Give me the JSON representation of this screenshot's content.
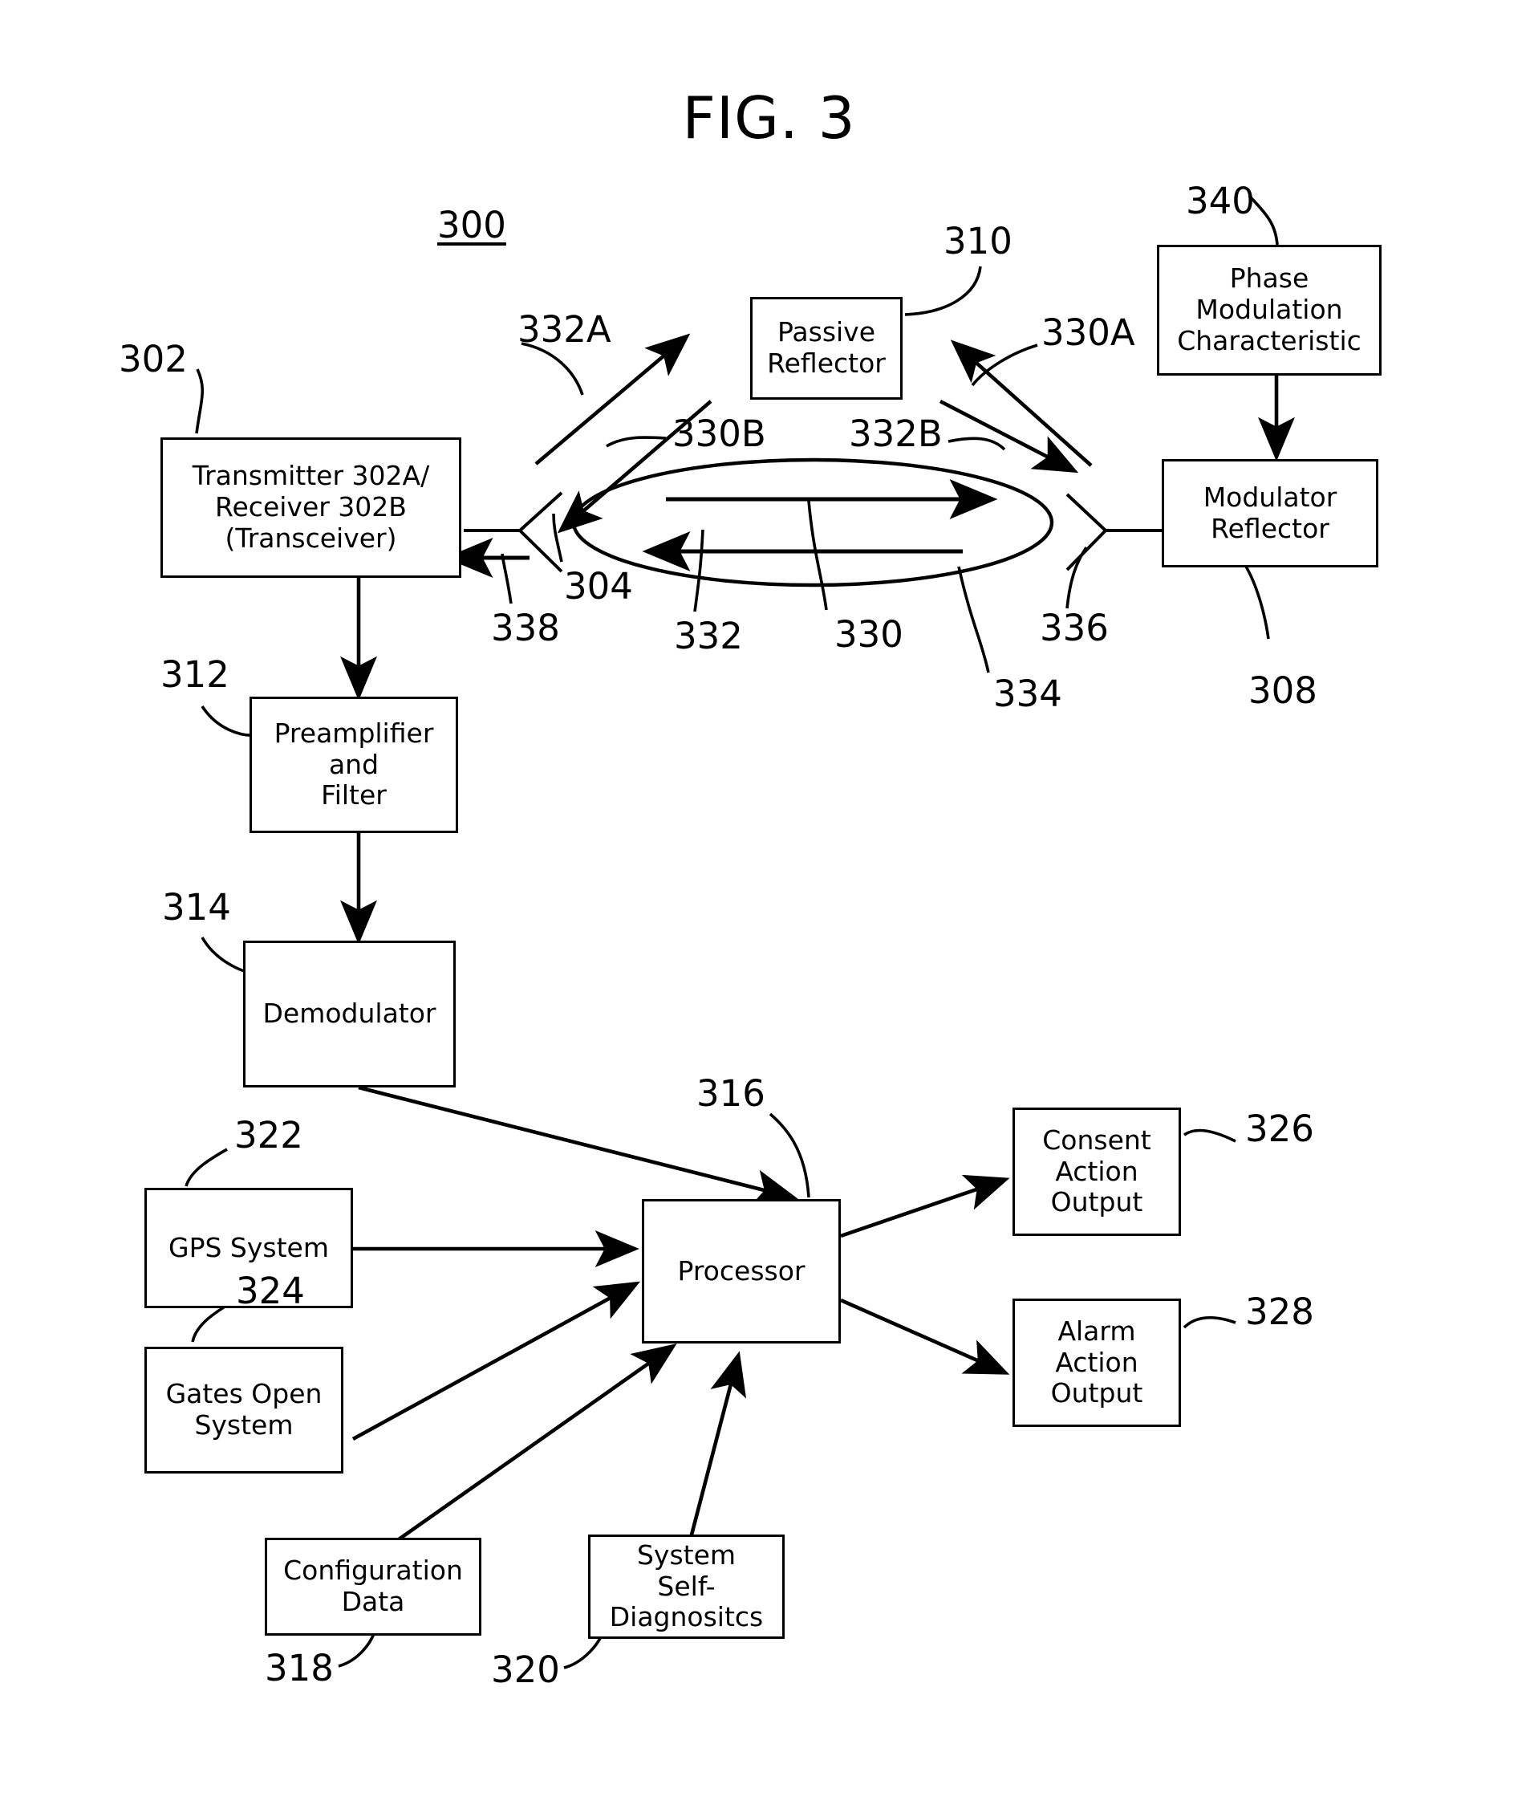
{
  "figure": {
    "title": "FIG. 3",
    "system_ref": "300"
  },
  "boxes": {
    "transceiver": {
      "label": "Transmitter 302A/\nReceiver 302B\n(Transceiver)",
      "ref": "302"
    },
    "passive_reflector": {
      "label": "Passive\nReflector",
      "ref": "310"
    },
    "phase_modulation_characteristic": {
      "label": "Phase\nModulation\nCharacteristic",
      "ref": "340"
    },
    "modulator_reflector": {
      "label": "Modulator\nReflector",
      "ref": "308"
    },
    "preamplifier_and_filter": {
      "label": "Preamplifier\nand\nFilter",
      "ref": "312"
    },
    "demodulator": {
      "label": "Demodulator",
      "ref": "314"
    },
    "processor": {
      "label": "Processor",
      "ref": "316"
    },
    "gps_system": {
      "label": "GPS System",
      "ref": "322"
    },
    "gates_open_system": {
      "label": "Gates Open\nSystem",
      "ref": "324"
    },
    "configuration_data": {
      "label": "Configuration\nData",
      "ref": "318"
    },
    "system_self_diagnostics": {
      "label": "System\nSelf-\nDiagnositcs",
      "ref": "320"
    },
    "consent_action_output": {
      "label": "Consent\nAction\nOutput",
      "ref": "326"
    },
    "alarm_action_output": {
      "label": "Alarm\nAction\nOutput",
      "ref": "328"
    }
  },
  "path_refs": {
    "antenna_left": "304",
    "antenna_left_return": "338",
    "antenna_right": "336",
    "direct_path_out": "332",
    "direct_path_in": "330",
    "ellipse_region": "334",
    "reflector_in_upper": "332A",
    "reflector_out_lower": "330B",
    "reflector_out_right": "332B",
    "reflector_in_right": "330A"
  },
  "colors": {
    "line": "#000000",
    "background": "#ffffff"
  }
}
